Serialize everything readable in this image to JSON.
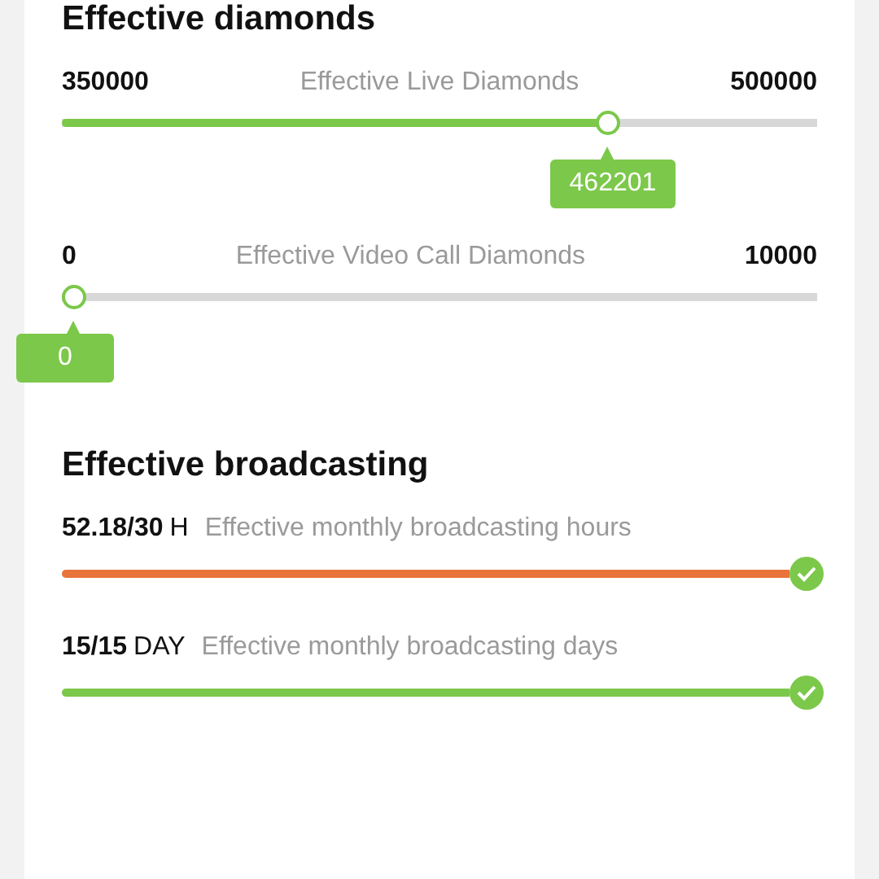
{
  "diamonds": {
    "title": "Effective diamonds",
    "sliders": [
      {
        "min": "350000",
        "label": "Effective Live Diamonds",
        "max": "500000",
        "level": 0.73,
        "reading": "462201"
      },
      {
        "min": "0",
        "label": "Effective Video Call Diamonds",
        "max": "10000",
        "level": 0,
        "reading": "0"
      }
    ]
  },
  "broadcasting": {
    "title": "Effective broadcasting",
    "items": [
      {
        "value": "52.18/30",
        "unit": "H",
        "label": "Effective monthly broadcasting hours",
        "level": 1,
        "color": "#e8743b",
        "done": true
      },
      {
        "value": "15/15",
        "unit": "DAY",
        "label": "Effective monthly broadcasting days",
        "level": 1,
        "color": "#7cc84a",
        "done": true
      }
    ]
  }
}
